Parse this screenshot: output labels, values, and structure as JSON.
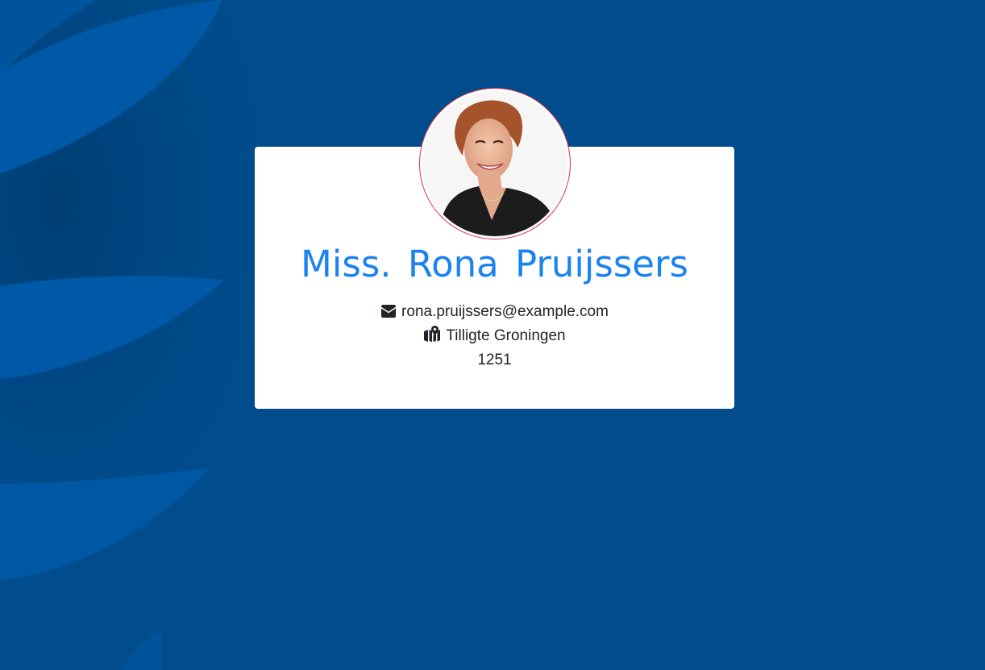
{
  "profile": {
    "name": "Miss. Rona Pruijssers",
    "email": "rona.pruijssers@example.com",
    "location": "Tilligte Groningen",
    "postcode": "1251"
  },
  "icons": {
    "email": "envelope-icon",
    "location": "map-marked-icon"
  },
  "colors": {
    "background": "#004c8c",
    "name": "#1a83f0",
    "avatar_border": "#e0324b",
    "card": "#ffffff",
    "text": "#212529"
  }
}
